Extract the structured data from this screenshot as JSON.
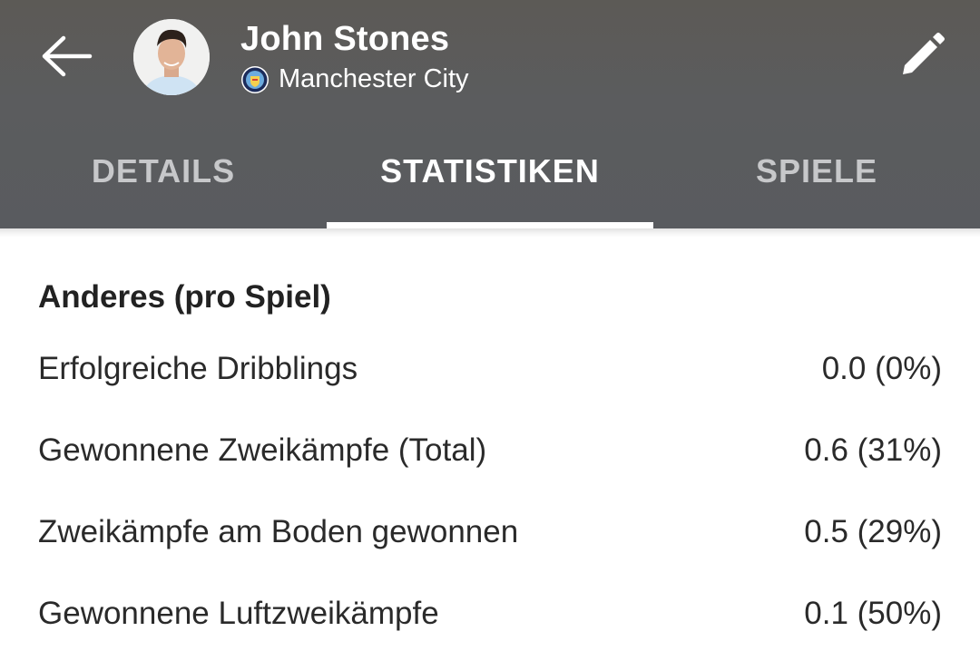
{
  "header": {
    "player_name": "John Stones",
    "club_name": "Manchester City",
    "colors": {
      "background": "#5b5c5e",
      "text": "#ffffff",
      "tab_inactive": "#c7c8ca"
    }
  },
  "icons": {
    "back": "arrow-left-icon",
    "edit": "pencil-icon",
    "club": "manchester-city-crest-icon"
  },
  "tabs": [
    {
      "label": "DETAILS",
      "active": false
    },
    {
      "label": "STATISTIKEN",
      "active": true
    },
    {
      "label": "SPIELE",
      "active": false
    }
  ],
  "section": {
    "title": "Anderes (pro Spiel)",
    "rows": [
      {
        "label": "Erfolgreiche Dribblings",
        "value": "0.0 (0%)"
      },
      {
        "label": "Gewonnene Zweikämpfe (Total)",
        "value": "0.6 (31%)"
      },
      {
        "label": "Zweikämpfe am Boden gewonnen",
        "value": "0.5 (29%)"
      },
      {
        "label": "Gewonnene Luftzweikämpfe",
        "value": "0.1 (50%)"
      }
    ]
  }
}
